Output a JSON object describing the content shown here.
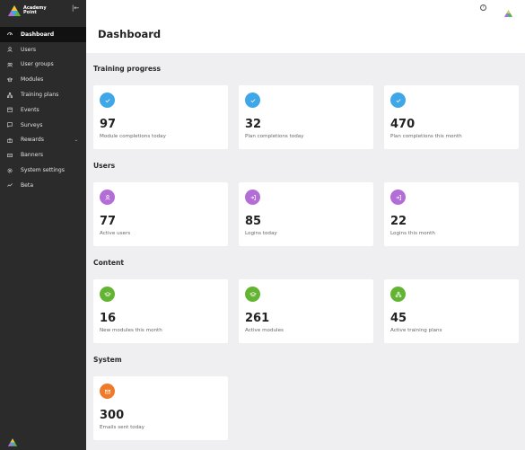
{
  "brand": {
    "name_line1": "Academy",
    "name_line2": "Point"
  },
  "sidebar": {
    "items": [
      {
        "label": "Dashboard",
        "icon": "dashboard-icon",
        "active": true
      },
      {
        "label": "Users",
        "icon": "user-icon"
      },
      {
        "label": "User groups",
        "icon": "user-groups-icon"
      },
      {
        "label": "Modules",
        "icon": "modules-icon"
      },
      {
        "label": "Training plans",
        "icon": "training-plans-icon"
      },
      {
        "label": "Events",
        "icon": "calendar-icon"
      },
      {
        "label": "Surveys",
        "icon": "surveys-icon"
      },
      {
        "label": "Rewards",
        "icon": "rewards-icon",
        "expandable": true
      },
      {
        "label": "Banners",
        "icon": "banners-icon"
      },
      {
        "label": "System settings",
        "icon": "gear-icon"
      },
      {
        "label": "Beta",
        "icon": "beta-icon"
      }
    ]
  },
  "topbar": {
    "help_icon": "?"
  },
  "page": {
    "title": "Dashboard"
  },
  "sections": {
    "training": {
      "title": "Training progress",
      "cards": [
        {
          "value": "97",
          "label": "Module completions today"
        },
        {
          "value": "32",
          "label": "Plan completions today"
        },
        {
          "value": "470",
          "label": "Plan completions this month"
        }
      ]
    },
    "users": {
      "title": "Users",
      "cards": [
        {
          "value": "77",
          "label": "Active users"
        },
        {
          "value": "85",
          "label": "Logins today"
        },
        {
          "value": "22",
          "label": "Logins this month"
        }
      ]
    },
    "content": {
      "title": "Content",
      "cards": [
        {
          "value": "16",
          "label": "New modules this month"
        },
        {
          "value": "261",
          "label": "Active modules"
        },
        {
          "value": "45",
          "label": "Active training plans"
        }
      ]
    },
    "system": {
      "title": "System",
      "cards": [
        {
          "value": "300",
          "label": "Emails sent today"
        }
      ]
    }
  },
  "colors": {
    "sidebar_bg": "#2b2b2b",
    "training": "#3fa7e8",
    "users": "#b36dd6",
    "content": "#64b433",
    "system": "#ee7a2a"
  }
}
